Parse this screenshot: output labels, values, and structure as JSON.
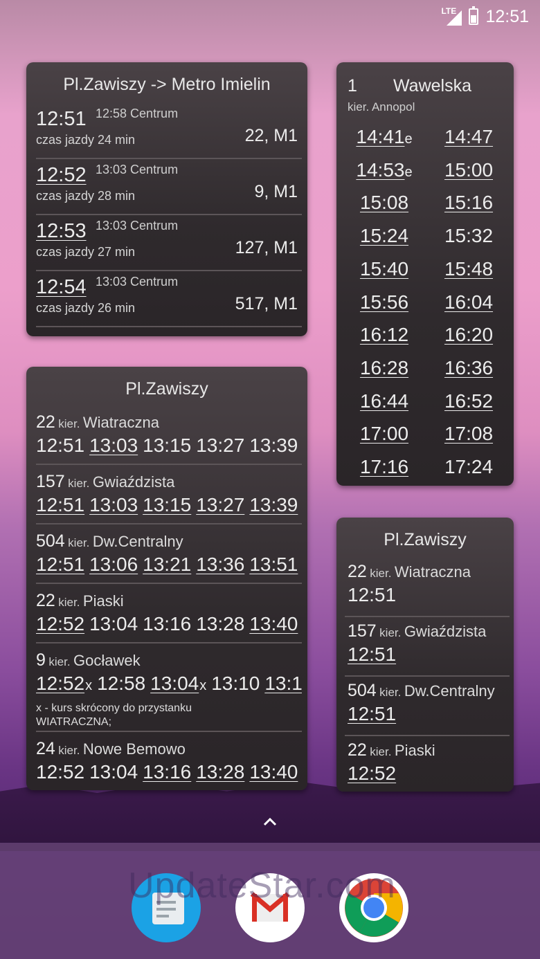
{
  "status_bar": {
    "network": "LTE",
    "time": "12:51"
  },
  "widget_route": {
    "title": "Pl.Zawiszy -> Metro Imielin",
    "trips": [
      {
        "time": "12:51",
        "dest": "12:58 Centrum",
        "duration": "czas jazdy 24 min",
        "lines": "22, M1"
      },
      {
        "time": "12:52",
        "dest": "13:03 Centrum",
        "duration": "czas jazdy 28 min",
        "lines": "9, M1"
      },
      {
        "time": "12:53",
        "dest": "13:03 Centrum",
        "duration": "czas jazdy 27 min",
        "lines": "127, M1"
      },
      {
        "time": "12:54",
        "dest": "13:03 Centrum",
        "duration": "czas jazdy 26 min",
        "lines": "517, M1"
      }
    ]
  },
  "widget_line": {
    "line": "1",
    "stop": "Wawelska",
    "direction": "kier. Annopol",
    "times": [
      {
        "t": "14:41",
        "suffix": "e"
      },
      {
        "t": "14:47",
        "suffix": ""
      },
      {
        "t": "14:53",
        "suffix": "e"
      },
      {
        "t": "15:00",
        "suffix": ""
      },
      {
        "t": "15:08",
        "suffix": ""
      },
      {
        "t": "15:16",
        "suffix": ""
      },
      {
        "t": "15:24",
        "suffix": ""
      },
      {
        "t": "15:32",
        "suffix": ""
      },
      {
        "t": "15:40",
        "suffix": ""
      },
      {
        "t": "15:48",
        "suffix": ""
      },
      {
        "t": "15:56",
        "suffix": ""
      },
      {
        "t": "16:04",
        "suffix": ""
      },
      {
        "t": "16:12",
        "suffix": ""
      },
      {
        "t": "16:20",
        "suffix": ""
      },
      {
        "t": "16:28",
        "suffix": ""
      },
      {
        "t": "16:36",
        "suffix": ""
      },
      {
        "t": "16:44",
        "suffix": ""
      },
      {
        "t": "16:52",
        "suffix": ""
      },
      {
        "t": "17:00",
        "suffix": ""
      },
      {
        "t": "17:08",
        "suffix": ""
      },
      {
        "t": "17:16",
        "suffix": ""
      },
      {
        "t": "17:24",
        "suffix": ""
      }
    ]
  },
  "widget_stop": {
    "title": "Pl.Zawiszy",
    "departures": [
      {
        "line": "22",
        "kier": "kier.",
        "to": "Wiatraczna",
        "times": [
          "12:51",
          "13:03",
          "13:15",
          "13:27",
          "13:39"
        ]
      },
      {
        "line": "157",
        "kier": "kier.",
        "to": "Gwiaździsta",
        "times": [
          "12:51",
          "13:03",
          "13:15",
          "13:27",
          "13:39"
        ]
      },
      {
        "line": "504",
        "kier": "kier.",
        "to": "Dw.Centralny",
        "times": [
          "12:51",
          "13:06",
          "13:21",
          "13:36",
          "13:51"
        ]
      },
      {
        "line": "22",
        "kier": "kier.",
        "to": "Piaski",
        "times": [
          "12:52",
          "13:04",
          "13:16",
          "13:28",
          "13:40"
        ]
      },
      {
        "line": "9",
        "kier": "kier.",
        "to": "Gocławek",
        "times": [
          "12:52",
          "12:58",
          "13:04",
          "13:10",
          "13:1"
        ],
        "note": "x - kurs skrócony do przystanku WIATRACZNA;"
      },
      {
        "line": "24",
        "kier": "kier.",
        "to": "Nowe Bemowo",
        "times": [
          "12:52",
          "13:04",
          "13:16",
          "13:28",
          "13:40"
        ]
      }
    ]
  },
  "widget_stop_small": {
    "title": "Pl.Zawiszy",
    "departures": [
      {
        "line": "22",
        "kier": "kier.",
        "to": "Wiatraczna",
        "time": "12:51"
      },
      {
        "line": "157",
        "kier": "kier.",
        "to": "Gwiaździsta",
        "time": "12:51"
      },
      {
        "line": "504",
        "kier": "kier.",
        "to": "Dw.Centralny",
        "time": "12:51"
      },
      {
        "line": "22",
        "kier": "kier.",
        "to": "Piaski",
        "time": "12:52"
      }
    ]
  },
  "x_mark": "x",
  "watermark": "UpdateStar.com",
  "dock": {
    "apps": [
      "docs-app-icon",
      "gmail-app-icon",
      "chrome-app-icon"
    ]
  }
}
